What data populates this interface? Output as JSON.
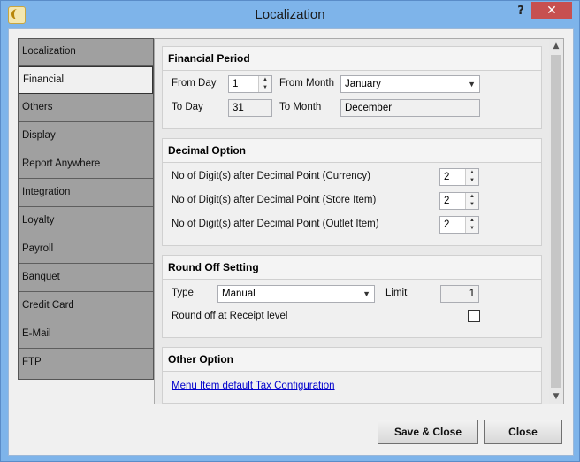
{
  "window": {
    "title": "Localization",
    "help": "?",
    "close": "✕"
  },
  "nav": {
    "items": [
      "Localization",
      "Financial",
      "Others",
      "Display",
      "Report Anywhere",
      "Integration",
      "Loyalty",
      "Payroll",
      "Banquet",
      "Credit Card",
      "E-Mail",
      "FTP"
    ],
    "active": "Financial"
  },
  "financial_period": {
    "title": "Financial Period",
    "from_day_label": "From Day",
    "from_day": "1",
    "from_month_label": "From Month",
    "from_month": "January",
    "to_day_label": "To Day",
    "to_day": "31",
    "to_month_label": "To Month",
    "to_month": "December"
  },
  "decimal_option": {
    "title": "Decimal Option",
    "currency_label": "No of Digit(s) after Decimal Point (Currency)",
    "currency": "2",
    "store_label": "No of Digit(s) after Decimal Point (Store Item)",
    "store": "2",
    "outlet_label": "No of Digit(s) after Decimal Point (Outlet Item)",
    "outlet": "2"
  },
  "round_off": {
    "title": "Round Off Setting",
    "type_label": "Type",
    "type": "Manual",
    "limit_label": "Limit",
    "limit": "1",
    "receipt_label": "Round off at Receipt level",
    "receipt_checked": false
  },
  "other_option": {
    "title": "Other Option",
    "link": "Menu Item default Tax Configuration"
  },
  "buttons": {
    "save_close": "Save & Close",
    "close": "Close"
  }
}
